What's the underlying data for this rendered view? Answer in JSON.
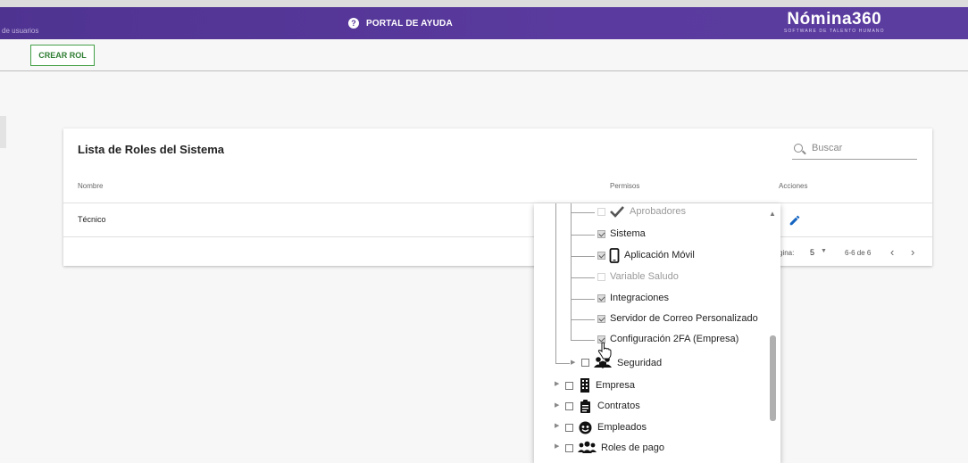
{
  "header": {
    "breadcrumb": "de usuarios",
    "help_label": "PORTAL DE AYUDA",
    "logo_title": "Nómina360",
    "logo_subtitle": "SOFTWARE DE TALENTO HUMANO"
  },
  "toolbar": {
    "create_role_label": "CREAR ROL"
  },
  "card": {
    "title": "Lista de Roles del Sistema",
    "search_placeholder": "Buscar",
    "columns": {
      "name": "Nombre",
      "permissions": "Permisos",
      "actions": "Acciones"
    },
    "rows": [
      {
        "name": "Técnico"
      }
    ],
    "pagination": {
      "label": "gina:",
      "page_size": "5",
      "range": "6-6 de 6"
    }
  },
  "permissions_tree": {
    "items": [
      {
        "label": "Aprobadores",
        "checked": false,
        "faded": true,
        "icon": "check-icon"
      },
      {
        "label": "Sistema",
        "checked": true
      },
      {
        "label": "Aplicación Móvil",
        "checked": true,
        "icon": "mobile-phone-icon"
      },
      {
        "label": "Variable Saludo",
        "checked": false,
        "faded": true
      },
      {
        "label": "Integraciones",
        "checked": true
      },
      {
        "label": "Servidor de Correo Personalizado",
        "checked": true
      },
      {
        "label": "Configuración 2FA (Empresa)",
        "checked": true
      },
      {
        "label": "Seguridad",
        "checked": false,
        "icon": "users-shield-icon"
      },
      {
        "label": "Empresa",
        "checked": false,
        "icon": "building-icon"
      },
      {
        "label": "Contratos",
        "checked": false,
        "icon": "clipboard-icon"
      },
      {
        "label": "Empleados",
        "checked": false,
        "icon": "employee-face-icon"
      },
      {
        "label": "Roles de pago",
        "checked": false,
        "icon": "users-group-icon"
      }
    ]
  },
  "colors": {
    "header_purple": "#5a3a9e",
    "create_button_green": "#43a047",
    "edit_icon_blue": "#1565c0"
  }
}
